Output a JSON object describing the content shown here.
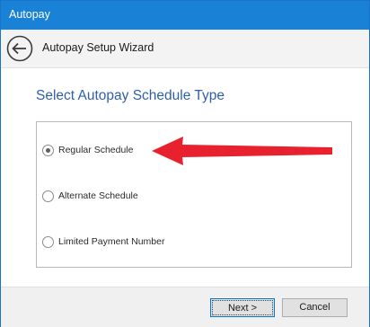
{
  "window": {
    "title": "Autopay",
    "accent_color": "#1a82d6"
  },
  "header": {
    "title": "Autopay Setup Wizard",
    "back_icon": "arrow-left-circle-icon"
  },
  "main": {
    "heading": "Select Autopay Schedule Type",
    "heading_color": "#2f5fa8",
    "options": [
      {
        "label": "Regular Schedule",
        "selected": true
      },
      {
        "label": "Alternate Schedule",
        "selected": false
      },
      {
        "label": "Limited Payment Number",
        "selected": false
      }
    ],
    "annotation_arrow_color": "#e8212e"
  },
  "footer": {
    "next_label": "Next >",
    "cancel_label": "Cancel"
  }
}
